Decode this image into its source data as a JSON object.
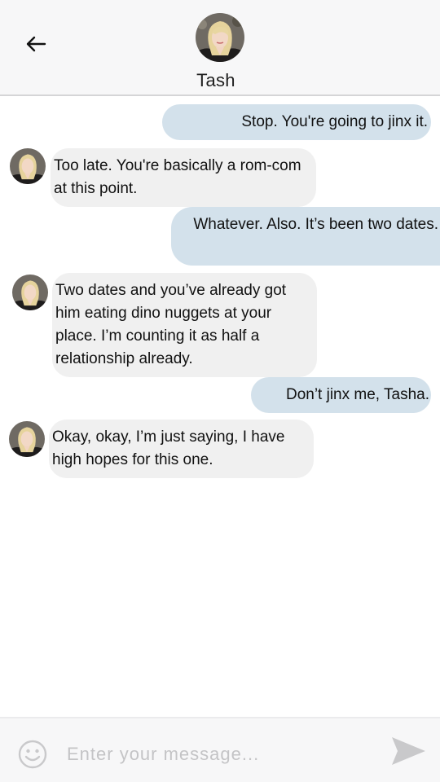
{
  "header": {
    "back_icon": "arrow-left-icon",
    "contact_name": "Tash",
    "avatar": "contact-photo"
  },
  "messages": [
    {
      "direction": "outgoing",
      "text": "Stop. You're going to jinx it."
    },
    {
      "direction": "incoming",
      "text": "Too late. You're basically a rom-com at this point."
    },
    {
      "direction": "outgoing",
      "text": "Whatever. Also. It’s been two dates."
    },
    {
      "direction": "incoming",
      "text": "Two dates and you’ve already got him eating dino nuggets at your place. I’m counting it as half a relationship already."
    },
    {
      "direction": "outgoing",
      "text": "Don’t jinx me, Tasha."
    },
    {
      "direction": "incoming",
      "text": "Okay, okay, I’m just saying, I have high hopes for this one."
    }
  ],
  "composer": {
    "emoji_icon": "smiley-face-icon",
    "placeholder": "Enter your message...",
    "value": "",
    "send_icon": "send-arrow-icon"
  },
  "colors": {
    "outgoing_bubble": "#d3e1eb",
    "incoming_bubble": "#f0f0f0",
    "header_bg": "#f7f7f8",
    "icon_gray": "#c9c9cb"
  }
}
